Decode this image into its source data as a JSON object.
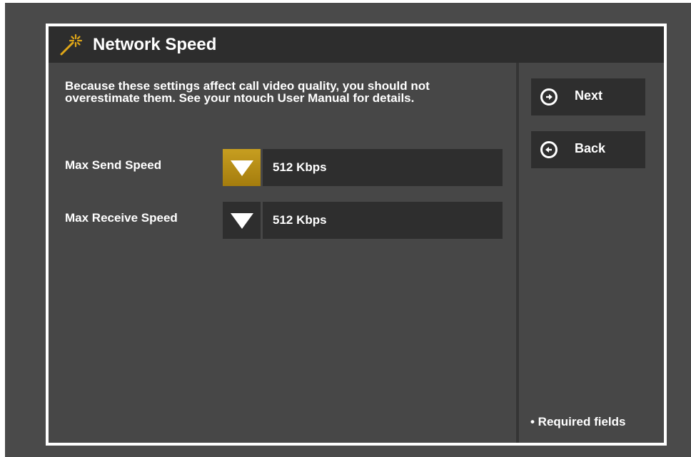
{
  "title": "Network Speed",
  "intro": "Because these settings affect call video quality, you should not overestimate them.  See your ntouch User Manual for details.",
  "fields": [
    {
      "label": "Max Send Speed",
      "value": "512 Kbps",
      "focused": true
    },
    {
      "label": "Max Receive Speed",
      "value": "512 Kbps",
      "focused": false
    }
  ],
  "nav": {
    "next_label": "Next",
    "back_label": "Back"
  },
  "required_note": "• Required fields",
  "icons": {
    "title": "magic-wand-icon",
    "next": "arrow-right-circle-icon",
    "back": "arrow-left-circle-icon",
    "dropdown": "triangle-down-icon"
  },
  "colors": {
    "accent": "#c79e20",
    "background": "#4a4a4a",
    "title_bar": "#2d2d2d",
    "control": "#2e2e2e",
    "frame_border": "#ffffff"
  }
}
